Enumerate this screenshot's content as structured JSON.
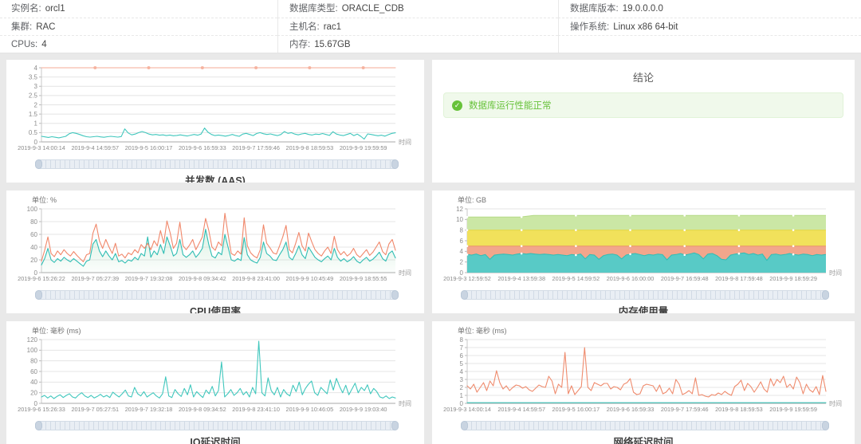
{
  "info_table": {
    "rows": [
      [
        {
          "label": "实例名:",
          "value": "orcl1"
        },
        {
          "label": "数据库类型:",
          "value": "ORACLE_CDB"
        },
        {
          "label": "数据库版本:",
          "value": "19.0.0.0.0"
        }
      ],
      [
        {
          "label": "集群:",
          "value": "RAC"
        },
        {
          "label": "主机名:",
          "value": "rac1"
        },
        {
          "label": "操作系统:",
          "value": "Linux x86 64-bit"
        }
      ],
      [
        {
          "label": "CPUs:",
          "value": "4"
        },
        {
          "label": "内存:",
          "value": "15.67GB"
        },
        {
          "label": "",
          "value": ""
        }
      ]
    ]
  },
  "conclusion": {
    "title": "结论",
    "status_text": "数据库运行性能正常",
    "status_color": "#67c23a",
    "box_bg": "#f0f9eb",
    "box_border": "#e1f3d8",
    "check_icon": "✓"
  },
  "time_axis_label": "时间",
  "chart_data": [
    {
      "id": "aas",
      "type": "line",
      "title": "并发数 (AAS)",
      "unit_label": "",
      "ylim": [
        0,
        4
      ],
      "ystep": 0.5,
      "grid": true,
      "legend": "none",
      "x_labels": [
        "2019-9-3 14:00:14",
        "2019-9-4 14:59:57",
        "2019-9-5 16:00:17",
        "2019-9-6 16:59:33",
        "2019-9-7 17:59:46",
        "2019-9-8 18:59:53",
        "2019-9-9 19:59:59"
      ],
      "series": [
        {
          "color": "#f5ab96",
          "markers": true,
          "values": [
            4,
            4
          ]
        },
        {
          "color": "#40c7bd",
          "values": [
            0.3,
            0.27,
            0.24,
            0.28,
            0.25,
            0.22,
            0.26,
            0.3,
            0.44,
            0.5,
            0.46,
            0.4,
            0.33,
            0.28,
            0.26,
            0.28,
            0.3,
            0.27,
            0.25,
            0.28,
            0.3,
            0.28,
            0.26,
            0.29,
            0.7,
            0.48,
            0.38,
            0.42,
            0.5,
            0.56,
            0.5,
            0.42,
            0.38,
            0.4,
            0.36,
            0.38,
            0.34,
            0.37,
            0.33,
            0.35,
            0.38,
            0.35,
            0.32,
            0.36,
            0.4,
            0.36,
            0.42,
            0.75,
            0.52,
            0.4,
            0.34,
            0.37,
            0.34,
            0.31,
            0.35,
            0.4,
            0.34,
            0.3,
            0.42,
            0.46,
            0.4,
            0.34,
            0.45,
            0.5,
            0.44,
            0.4,
            0.43,
            0.38,
            0.34,
            0.4,
            0.56,
            0.46,
            0.5,
            0.42,
            0.38,
            0.43,
            0.46,
            0.4,
            0.37,
            0.42,
            0.4,
            0.45,
            0.4,
            0.35,
            0.55,
            0.42,
            0.37,
            0.34,
            0.4,
            0.46,
            0.34,
            0.42,
            0.3,
            0.15,
            0.43,
            0.4,
            0.36,
            0.33,
            0.36,
            0.31,
            0.39,
            0.46,
            0.49
          ]
        }
      ]
    },
    {
      "id": "cpu",
      "type": "line",
      "title": "CPU使用率",
      "unit_label": "单位: %",
      "ylim": [
        0,
        100
      ],
      "ystep": 20,
      "grid": true,
      "legend": "none",
      "x_labels": [
        "2019-9-6 15:26:22",
        "2019-9-7 05:27:39",
        "2019-9-7 19:32:08",
        "2019-9-8 09:34:42",
        "2019-9-8 23:41:00",
        "2019-9-9 10:45:49",
        "2019-9-9 18:55:55"
      ],
      "series": [
        {
          "color": "#2fbdb3",
          "area": true,
          "area_color": "#bfe5cc",
          "values": [
            12,
            22,
            38,
            20,
            16,
            22,
            18,
            24,
            20,
            17,
            22,
            18,
            14,
            10,
            18,
            20,
            45,
            52,
            34,
            25,
            34,
            26,
            20,
            30,
            17,
            19,
            15,
            20,
            18,
            24,
            20,
            30,
            26,
            56,
            24,
            34,
            28,
            44,
            30,
            56,
            42,
            26,
            30,
            52,
            28,
            24,
            28,
            34,
            24,
            30,
            38,
            68,
            44,
            26,
            23,
            32,
            28,
            60,
            40,
            20,
            18,
            22,
            19,
            55,
            28,
            20,
            17,
            15,
            24,
            48,
            30,
            26,
            20,
            19,
            28,
            36,
            48,
            24,
            20,
            30,
            42,
            28,
            22,
            40,
            32,
            24,
            20,
            17,
            22,
            26,
            20,
            38,
            24,
            18,
            22,
            17,
            20,
            25,
            18,
            15,
            20,
            24,
            18,
            21,
            26,
            32,
            22,
            18,
            30,
            34,
            23
          ]
        },
        {
          "color": "#f0876a",
          "values": [
            18,
            35,
            56,
            30,
            25,
            34,
            28,
            36,
            30,
            26,
            33,
            27,
            22,
            17,
            28,
            30,
            62,
            76,
            50,
            38,
            52,
            40,
            30,
            46,
            26,
            29,
            23,
            31,
            28,
            36,
            31,
            44,
            38,
            46,
            36,
            50,
            42,
            66,
            46,
            81,
            62,
            38,
            46,
            79,
            42,
            36,
            43,
            52,
            36,
            46,
            56,
            85,
            66,
            40,
            35,
            48,
            42,
            93,
            60,
            30,
            27,
            34,
            29,
            86,
            42,
            31,
            26,
            23,
            36,
            75,
            46,
            39,
            31,
            29,
            42,
            56,
            74,
            36,
            31,
            46,
            63,
            42,
            34,
            62,
            48,
            36,
            30,
            26,
            34,
            40,
            30,
            57,
            36,
            28,
            33,
            26,
            30,
            38,
            28,
            24,
            30,
            36,
            27,
            32,
            40,
            48,
            33,
            28,
            45,
            52,
            35
          ]
        }
      ]
    },
    {
      "id": "memory",
      "type": "stacked_area",
      "title": "内存使用量",
      "unit_label": "单位: GB",
      "ylim": [
        0,
        12
      ],
      "ystep": 2,
      "grid": true,
      "legend": "none",
      "note": "series values are cumulative stack tops in GB",
      "x_labels": [
        "2019-9-3 12:59:52",
        "2019-9-4 13:59:38",
        "2019-9-5 14:59:52",
        "2019-9-6 16:00:00",
        "2019-9-7 16:59:48",
        "2019-9-8 17:59:48",
        "2019-9-9 18:59:29"
      ],
      "series": [
        {
          "color": "#cbe7a5",
          "line": "#b4da87",
          "dots": true,
          "values": [
            10.45,
            10.45,
            10.45,
            10.45,
            10.45,
            10.75,
            10.75,
            10.75,
            10.75,
            10.75,
            10.75,
            10.75,
            10.75,
            10.75,
            10.75,
            10.75,
            10.75,
            10.75,
            10.75,
            10.75,
            10.75,
            10.75,
            10.75,
            10.75,
            10.75,
            10.75,
            10.75,
            10.75
          ]
        },
        {
          "color": "#f1e15b",
          "line": "#e6d53f",
          "dots": true,
          "values": [
            8,
            8
          ]
        },
        {
          "color": "#f2a68c",
          "line": "#ea9170",
          "dots": true,
          "values": [
            5,
            5
          ]
        },
        {
          "color": "#58cac6",
          "line": "#2fbdb5",
          "dots": true,
          "values": [
            3.4,
            3.3,
            3.5,
            3.2,
            3.4,
            2.5,
            3.3,
            3.4,
            3.5,
            3.4,
            3.3,
            3.5,
            3.6,
            3.5,
            3.6,
            3.5,
            3.4,
            3.5,
            3.4,
            3.3,
            3.4,
            3.3,
            3.2,
            3.4,
            3.3,
            3.5,
            2.6,
            3.4,
            3.3,
            2.5,
            3.2,
            3.4,
            3.5,
            3.3,
            2.6,
            3.3,
            3.5,
            3.6,
            3.4,
            3.2,
            3.4,
            3.3,
            3.5,
            3.4,
            2.4,
            3.3,
            3.4,
            3.6,
            3.3,
            3.5,
            3.7,
            3.4,
            2.6,
            3.5,
            3.6,
            3.2,
            2.5,
            2.4,
            3.3,
            3.5,
            3.6,
            3.7,
            3.4,
            3.6,
            3.3,
            3.5,
            2.3,
            3.4,
            3.5,
            3.3,
            3.4,
            3.6,
            3.4,
            3.3,
            3.5,
            3.4,
            3.2,
            3.4,
            3.3,
            3.4
          ]
        }
      ]
    },
    {
      "id": "io",
      "type": "line",
      "title": "IO延迟时间",
      "unit_label": "单位: 毫秒 (ms)",
      "ylim": [
        0,
        120
      ],
      "ystep": 20,
      "grid": true,
      "legend": "none",
      "x_labels": [
        "2019-9-6 15:26:33",
        "2019-9-7 05:27:51",
        "2019-9-7 19:32:18",
        "2019-9-8 09:34:52",
        "2019-9-8 23:41:10",
        "2019-9-9 10:46:05",
        "2019-9-9 19:03:40"
      ],
      "series": [
        {
          "color": "#40c7bd",
          "values": [
            12,
            15,
            10,
            14,
            9,
            13,
            16,
            11,
            15,
            18,
            12,
            10,
            16,
            20,
            14,
            11,
            15,
            10,
            13,
            17,
            12,
            15,
            11,
            21,
            16,
            12,
            18,
            25,
            14,
            12,
            30,
            18,
            14,
            22,
            12,
            16,
            20,
            14,
            10,
            18,
            50,
            14,
            11,
            26,
            18,
            13,
            28,
            16,
            35,
            12,
            22,
            16,
            11,
            25,
            18,
            32,
            14,
            24,
            78,
            12,
            18,
            26,
            15,
            20,
            28,
            16,
            22,
            12,
            30,
            18,
            117,
            20,
            14,
            48,
            24,
            16,
            30,
            12,
            26,
            18,
            14,
            34,
            22,
            40,
            16,
            28,
            36,
            42,
            20,
            15,
            30,
            24,
            18,
            44,
            25,
            47,
            32,
            20,
            34,
            16,
            27,
            38,
            20,
            30,
            24,
            35,
            18,
            28,
            22,
            12,
            10,
            14,
            9,
            12,
            10
          ]
        }
      ]
    },
    {
      "id": "network",
      "type": "line",
      "title": "网络延迟时间",
      "unit_label": "单位: 毫秒 (ms)",
      "ylim": [
        0,
        8
      ],
      "ystep": 1,
      "grid": true,
      "legend": "none",
      "x_labels": [
        "2019-9-3 14:00:14",
        "2019-9-4 14:59:57",
        "2019-9-5 16:00:17",
        "2019-9-6 16:59:33",
        "2019-9-7 17:59:46",
        "2019-9-8 18:59:53",
        "2019-9-9 19:59:59"
      ],
      "series": [
        {
          "color": "#ef8b6d",
          "values": [
            2.2,
            1.8,
            2.4,
            1.4,
            2.0,
            2.6,
            1.6,
            2.8,
            2.2,
            4.1,
            2.6,
            1.8,
            2.2,
            1.6,
            2.0,
            2.3,
            2.2,
            1.9,
            2.1,
            1.7,
            1.5,
            1.9,
            2.3,
            2.1,
            2.0,
            3.4,
            2.8,
            1.2,
            2.4,
            2.0,
            6.4,
            1.2,
            2.2,
            1.1,
            1.6,
            2.1,
            7.0,
            2.0,
            1.6,
            2.6,
            2.4,
            2.2,
            2.5,
            2.5,
            1.8,
            2.1,
            2.0,
            1.7,
            2.4,
            2.6,
            3.1,
            1.4,
            1.1,
            1.2,
            2.2,
            2.4,
            2.3,
            2.2,
            1.5,
            2.3,
            1.2,
            1.4,
            1.9,
            1.2,
            3.0,
            2.4,
            1.1,
            1.3,
            1.6,
            1.2,
            3.2,
            1.0,
            1.1,
            0.9,
            0.8,
            1.1,
            1.0,
            1.3,
            1.1,
            1.5,
            1.2,
            1.0,
            2.1,
            2.4,
            2.9,
            1.6,
            2.5,
            2.1,
            1.4,
            2.0,
            2.7,
            1.8,
            1.4,
            3.1,
            2.2,
            3.0,
            2.6,
            3.4,
            2.0,
            2.4,
            1.8,
            3.3,
            2.6,
            1.2,
            2.4,
            1.7,
            1.4,
            2.1,
            1.1,
            3.5,
            1.5
          ]
        },
        {
          "color": "#3fc5bb",
          "values": [
            0.08,
            0.08
          ]
        }
      ]
    }
  ]
}
